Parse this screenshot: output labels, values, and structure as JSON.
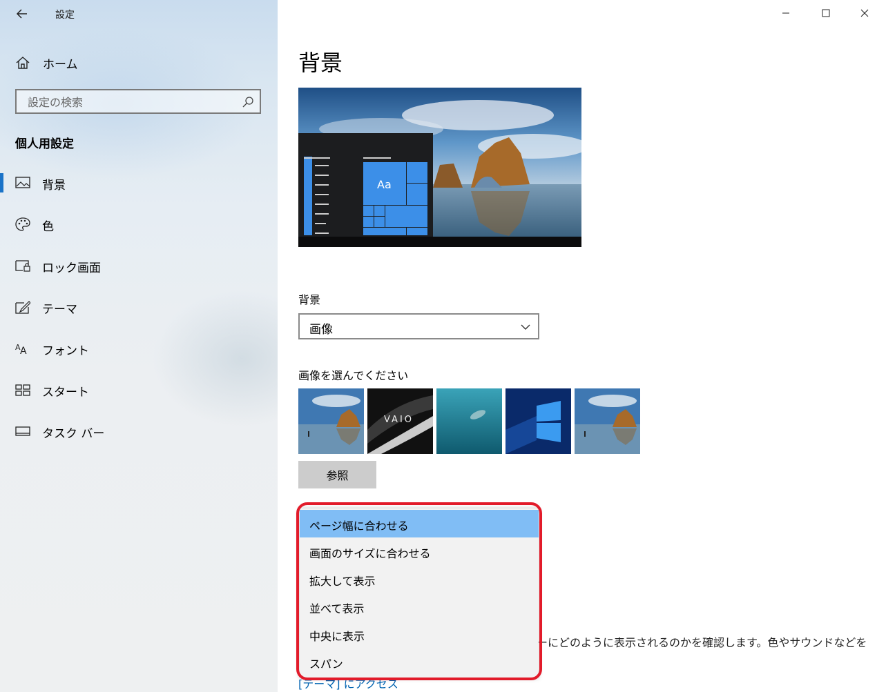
{
  "window": {
    "title": "設定",
    "controls": [
      "minimize-icon",
      "maximize-icon",
      "close-icon"
    ]
  },
  "sidebar": {
    "home_label": "ホーム",
    "search_placeholder": "設定の検索",
    "section_title": "個人用設定",
    "items": [
      {
        "label": "背景",
        "icon": "picture-icon",
        "active": true
      },
      {
        "label": "色",
        "icon": "palette-icon",
        "active": false
      },
      {
        "label": "ロック画面",
        "icon": "lock-screen-icon",
        "active": false
      },
      {
        "label": "テーマ",
        "icon": "theme-brush-icon",
        "active": false
      },
      {
        "label": "フォント",
        "icon": "font-icon",
        "active": false
      },
      {
        "label": "スタート",
        "icon": "start-tiles-icon",
        "active": false
      },
      {
        "label": "タスク バー",
        "icon": "taskbar-icon",
        "active": false
      }
    ]
  },
  "main": {
    "page_title": "背景",
    "preview_tile_label": "Aa",
    "background_label": "背景",
    "background_value": "画像",
    "choose_picture_label": "画像を選んでください",
    "thumbnail_brand": "VAIO",
    "browse_label": "参照",
    "behind_text": "ーにどのように表示されるのかを確認します。色やサウンドなどを",
    "behind_link": "[テーマ] にアクセス"
  },
  "fit_dropdown": {
    "options": [
      "ページ幅に合わせる",
      "画面のサイズに合わせる",
      "拡大して表示",
      "並べて表示",
      "中央に表示",
      "スパン"
    ],
    "selected_index": 0,
    "highlight_color": "#e21b2a"
  },
  "colors": {
    "accent": "#1a73c8",
    "selected_option": "#80bdf5",
    "tile_blue": "#3c8fe8"
  }
}
